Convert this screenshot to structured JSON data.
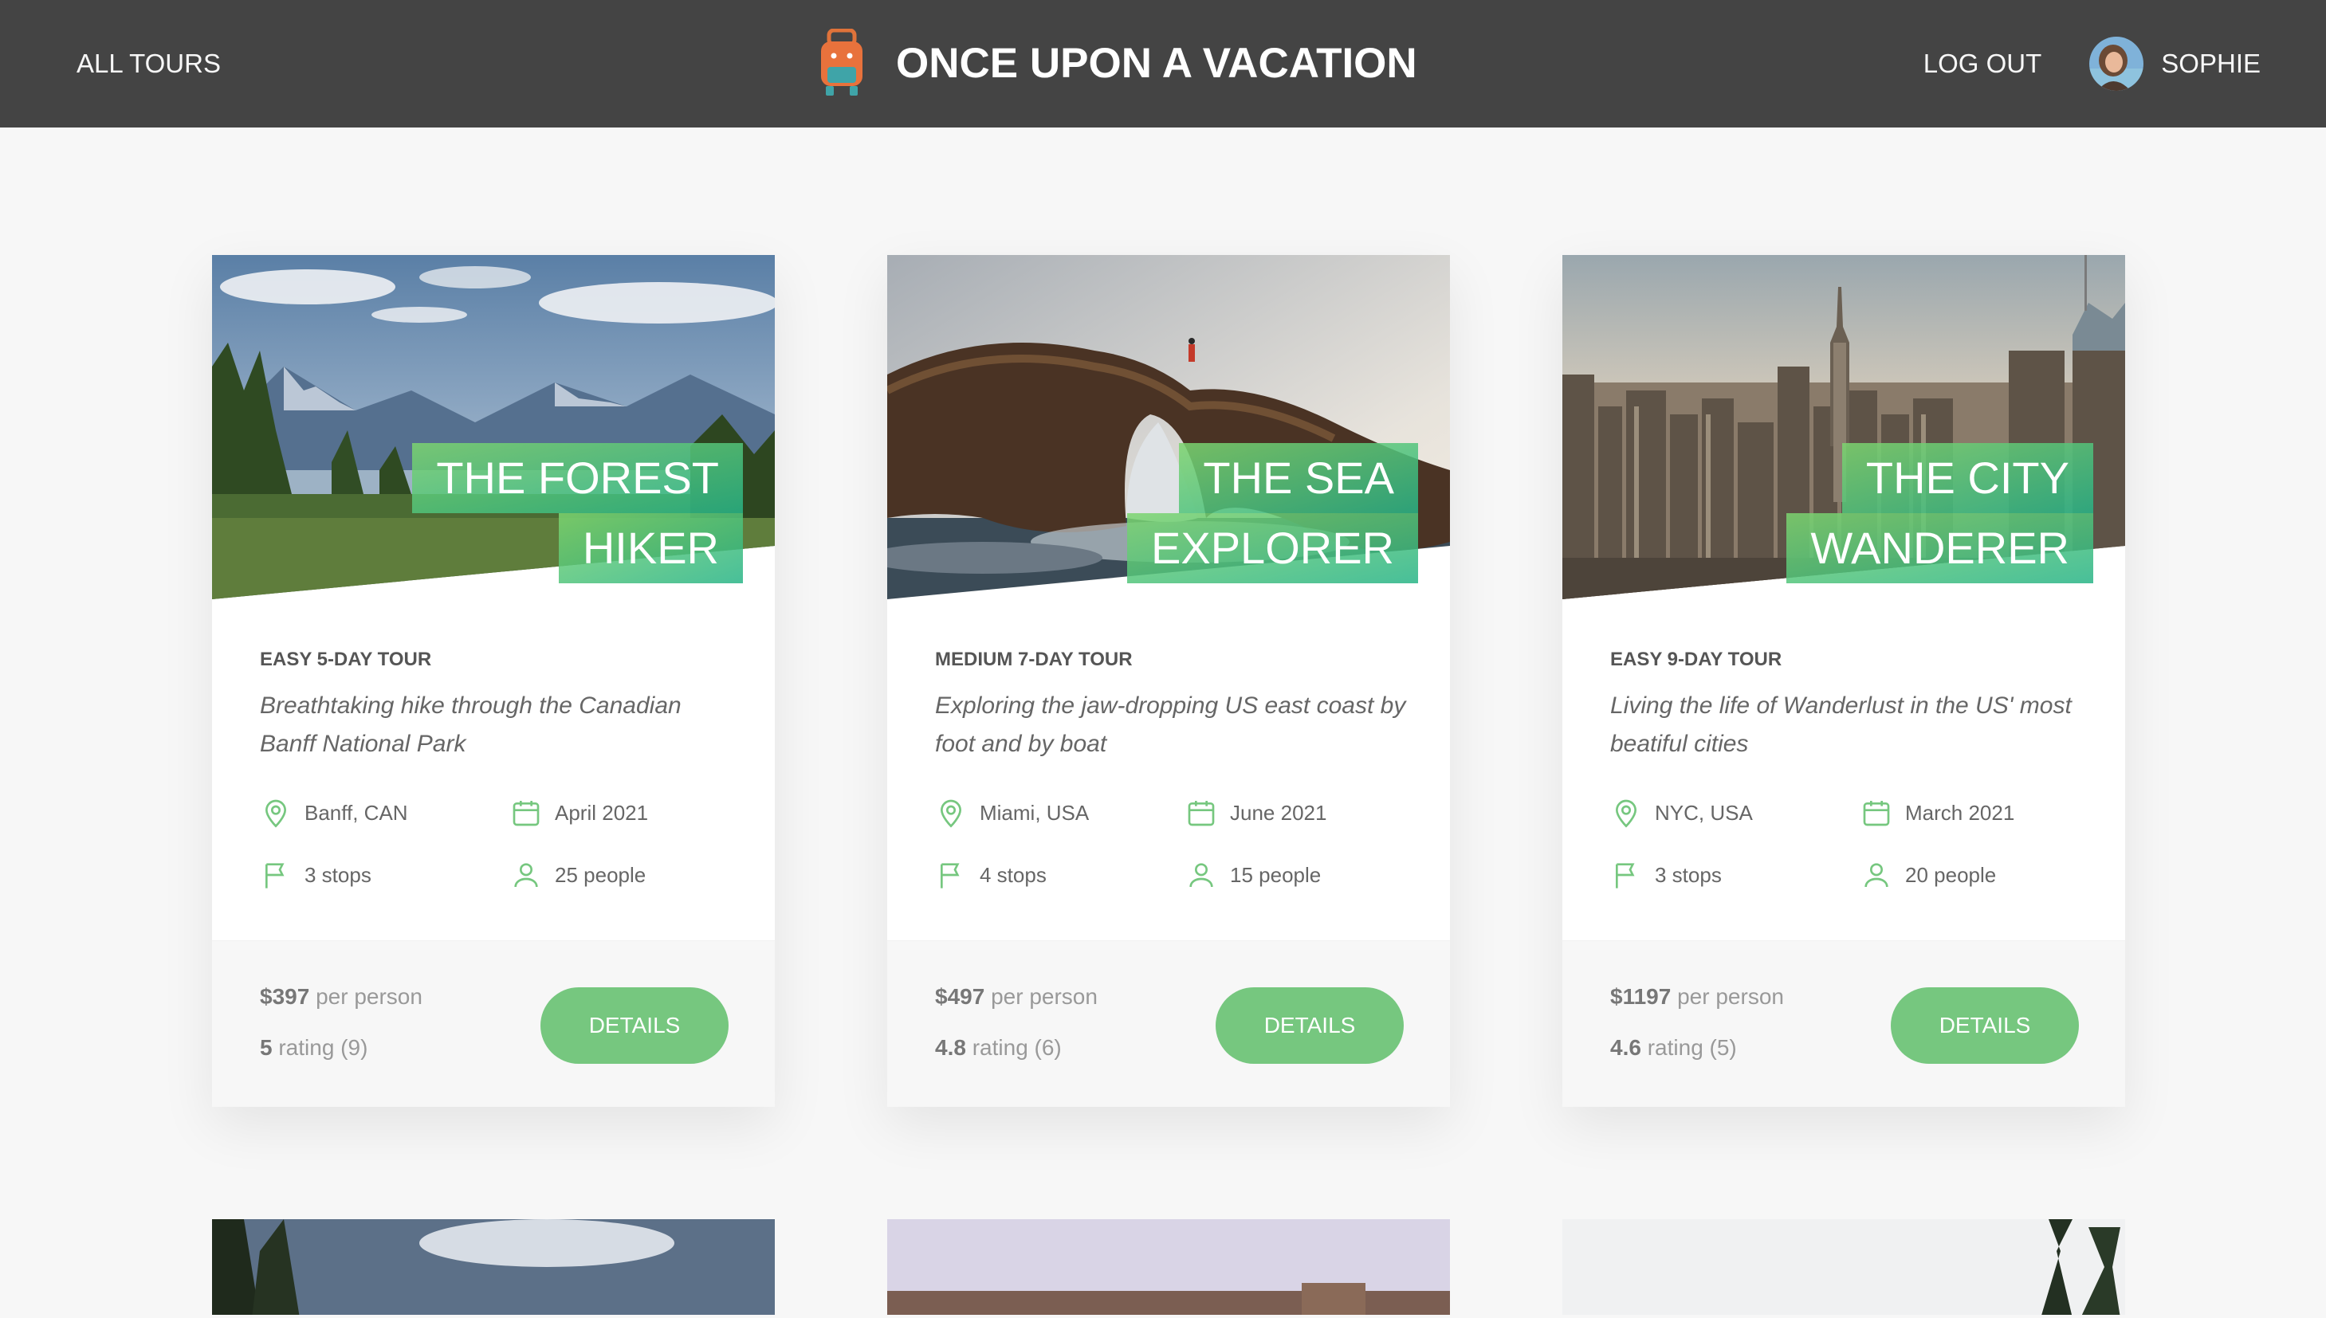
{
  "header": {
    "all_tours": "All tours",
    "brand": "ONCE UPON A VACATION",
    "logout": "Log out",
    "user_name": "Sophie"
  },
  "colors": {
    "header_bg": "#444444",
    "accent": "#76c77f",
    "page_bg": "#f7f7f7"
  },
  "cards": [
    {
      "title_line1": "The Forest",
      "title_line2": "Hiker",
      "sub": "Easy 5-day tour",
      "desc": "Breathtaking hike through the Canadian Banff National Park",
      "location": "Banff, CAN",
      "date": "April 2021",
      "stops": "3 stops",
      "people": "25 people",
      "price": "$397",
      "price_suffix": "per person",
      "rating": "5",
      "rating_suffix": "rating (9)",
      "button": "Details"
    },
    {
      "title_line1": "The Sea",
      "title_line2": "Explorer",
      "sub": "Medium 7-day tour",
      "desc": "Exploring the jaw-dropping US east coast by foot and by boat",
      "location": "Miami, USA",
      "date": "June 2021",
      "stops": "4 stops",
      "people": "15 people",
      "price": "$497",
      "price_suffix": "per person",
      "rating": "4.8",
      "rating_suffix": "rating (6)",
      "button": "Details"
    },
    {
      "title_line1": "The City",
      "title_line2": "Wanderer",
      "sub": "Easy 9-day tour",
      "desc": "Living the life of Wanderlust in the US' most beatiful cities",
      "location": "NYC, USA",
      "date": "March 2021",
      "stops": "3 stops",
      "people": "20 people",
      "price": "$1197",
      "price_suffix": "per person",
      "rating": "4.6",
      "rating_suffix": "rating (5)",
      "button": "Details"
    }
  ],
  "icons": {
    "location": "map-pin-icon",
    "date": "calendar-icon",
    "stops": "flag-icon",
    "people": "user-icon"
  }
}
